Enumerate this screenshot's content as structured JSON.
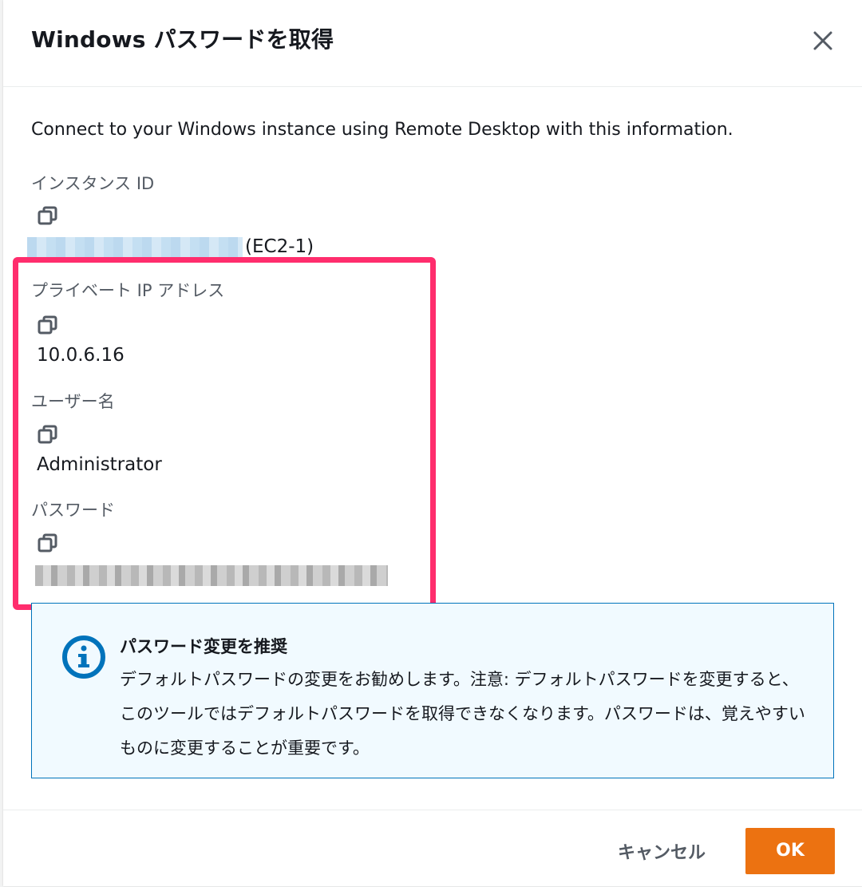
{
  "modal": {
    "title": "Windows パスワードを取得",
    "description": "Connect to your Windows instance using Remote Desktop with this information."
  },
  "fields": {
    "instance_id": {
      "label": "インスタンス ID",
      "value_suffix": "(EC2-1)"
    },
    "private_ip": {
      "label": "プライベート IP アドレス",
      "value": "10.0.6.16"
    },
    "username": {
      "label": "ユーザー名",
      "value": "Administrator"
    },
    "password": {
      "label": "パスワード"
    }
  },
  "alert": {
    "title": "パスワード変更を推奨",
    "body": "デフォルトパスワードの変更をお勧めします。注意: デフォルトパスワードを変更すると、このツールではデフォルトパスワードを取得できなくなります。パスワードは、覚えやすいものに変更することが重要です。"
  },
  "footer": {
    "cancel_label": "キャンセル",
    "ok_label": "OK"
  },
  "colors": {
    "primary_button": "#ec7211",
    "highlight_border": "#ff2d6d",
    "info_border": "#0073bb",
    "info_background": "#f1faff"
  }
}
